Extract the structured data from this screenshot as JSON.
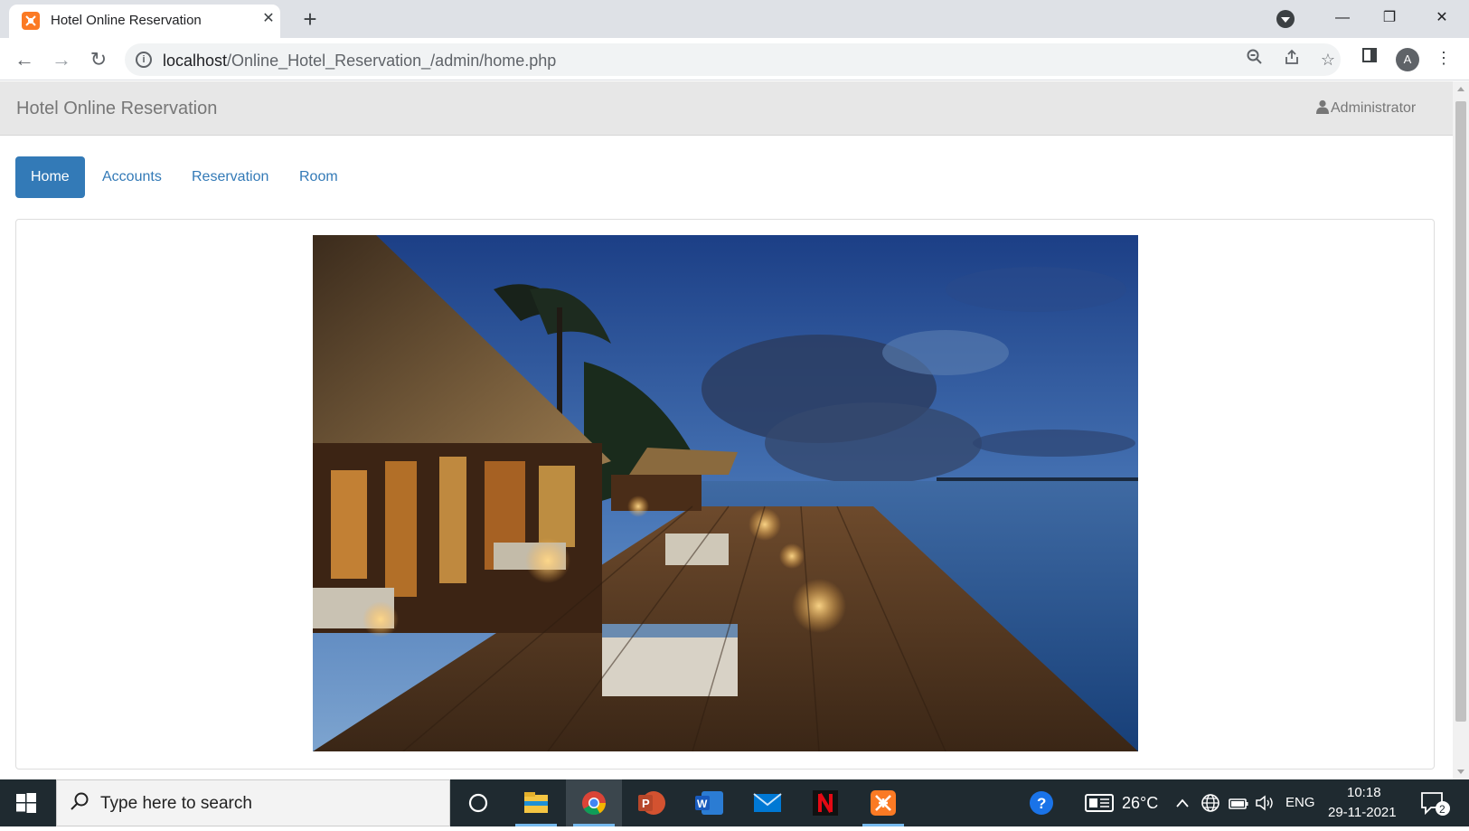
{
  "browser": {
    "tab_title": "Hotel Online Reservation",
    "url_host": "localhost",
    "url_path": "/Online_Hotel_Reservation_/admin/home.php",
    "profile_initial": "A"
  },
  "page": {
    "brand": "Hotel Online Reservation",
    "user": "Administrator",
    "nav": [
      {
        "label": "Home",
        "active": true
      },
      {
        "label": "Accounts",
        "active": false
      },
      {
        "label": "Reservation",
        "active": false
      },
      {
        "label": "Room",
        "active": false
      }
    ]
  },
  "taskbar": {
    "search_placeholder": "Type here to search",
    "temperature": "26°C",
    "language": "ENG",
    "time": "10:18",
    "date": "29-11-2021",
    "notification_count": "2"
  },
  "colors": {
    "primary": "#337ab7",
    "navbar_bg": "#e7e7e7",
    "xampp_orange": "#fb7a24",
    "taskbar_bg": "#1f2a30"
  }
}
